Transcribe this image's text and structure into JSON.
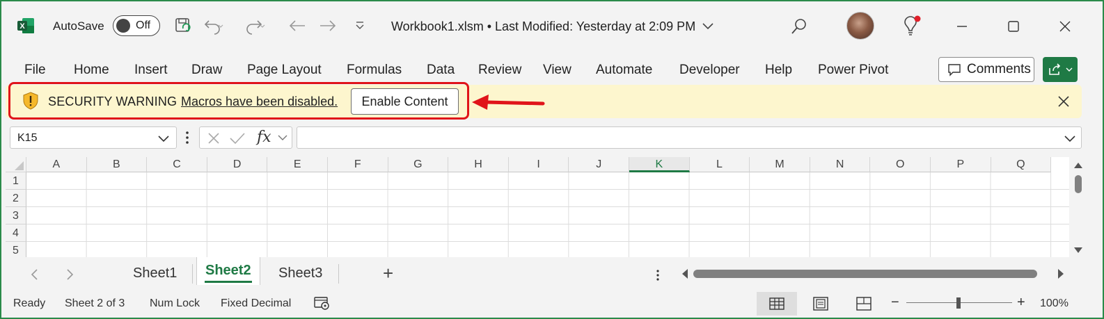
{
  "titlebar": {
    "autosave_label": "AutoSave",
    "autosave_state": "Off",
    "document_title": "Workbook1.xlsm • Last Modified: Yesterday at 2:09 PM"
  },
  "menu": {
    "items": [
      "File",
      "Home",
      "Insert",
      "Draw",
      "Page Layout",
      "Formulas",
      "Data",
      "Review",
      "View",
      "Automate",
      "Developer",
      "Help",
      "Power Pivot"
    ],
    "comments_label": "Comments"
  },
  "security_bar": {
    "title": "SECURITY WARNING",
    "message": "Macros have been disabled.",
    "button_label": "Enable Content"
  },
  "formula_bar": {
    "name_box": "K15",
    "fx_label": "fx",
    "formula": ""
  },
  "grid": {
    "columns": [
      "A",
      "B",
      "C",
      "D",
      "E",
      "F",
      "G",
      "H",
      "I",
      "J",
      "K",
      "L",
      "M",
      "N",
      "O",
      "P",
      "Q"
    ],
    "active_column": "K",
    "rows": [
      "1",
      "2",
      "3",
      "4",
      "5"
    ]
  },
  "sheets": {
    "tabs": [
      "Sheet1",
      "Sheet2",
      "Sheet3"
    ],
    "active": "Sheet2",
    "add_label": "+"
  },
  "status": {
    "mode": "Ready",
    "sheet_position": "Sheet 2 of 3",
    "num_lock": "Num Lock",
    "fixed_decimal": "Fixed Decimal",
    "zoom": "100%",
    "zoom_minus": "−",
    "zoom_plus": "+"
  },
  "colors": {
    "brand_green": "#1f7a45",
    "warning_bg": "#fdf6ce",
    "highlight_red": "#e0141a"
  }
}
